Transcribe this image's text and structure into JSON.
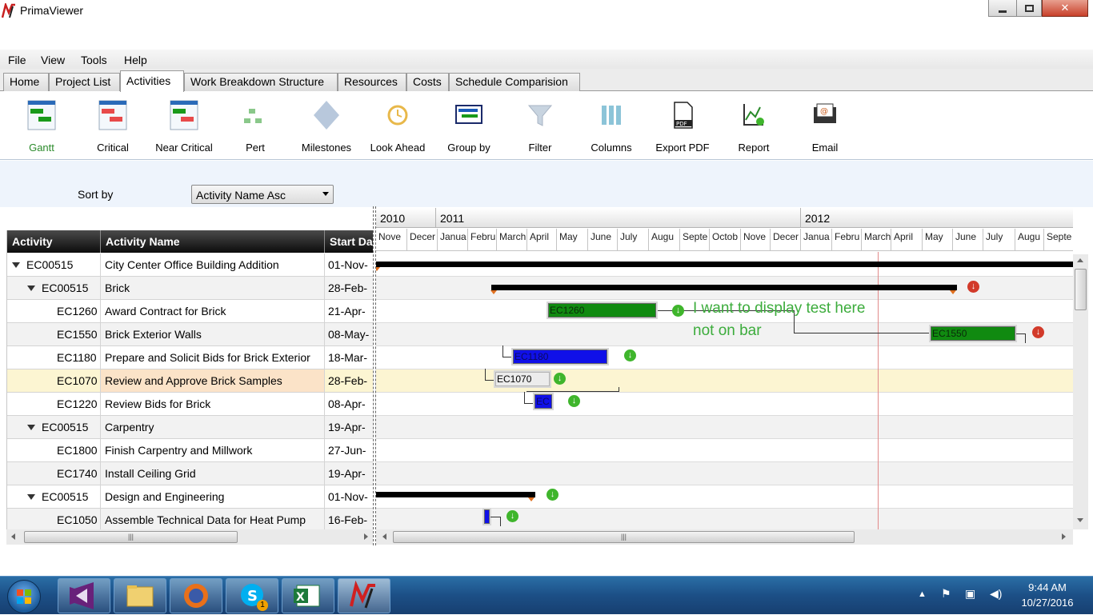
{
  "window": {
    "title": "PrimaViewer"
  },
  "menu": [
    "File",
    "View",
    "Tools",
    "Help"
  ],
  "tabs": [
    "Home",
    "Project List",
    "Activities",
    "Work Breakdown Structure",
    "Resources",
    "Costs",
    "Schedule Comparision"
  ],
  "ribbon": {
    "gantt": "Gantt",
    "critical": "Critical",
    "near_critical": "Near Critical",
    "pert": "Pert",
    "milestones": "Milestones",
    "look_ahead": "Look Ahead",
    "group_by": "Group by",
    "filter": "Filter",
    "columns": "Columns",
    "export_pdf": "Export PDF",
    "report": "Report",
    "email": "Email",
    "active_color": "#2a8a2a"
  },
  "sort": {
    "label": "Sort by",
    "value": "Activity Name Asc"
  },
  "grid": {
    "columns": [
      "Activity",
      "Activity Name",
      "Start Da"
    ],
    "rows": [
      {
        "id": "EC00515",
        "name": "City Center Office Building Addition",
        "start": "01-Nov-"
      },
      {
        "id": "EC00515",
        "name": "Brick",
        "start": "28-Feb-"
      },
      {
        "id": "EC1260",
        "name": "Award Contract for Brick",
        "start": "21-Apr-"
      },
      {
        "id": "EC1550",
        "name": "Brick Exterior Walls",
        "start": "08-May-"
      },
      {
        "id": "EC1180",
        "name": "Prepare and Solicit Bids for Brick Exterior",
        "start": "18-Mar-"
      },
      {
        "id": "EC1070",
        "name": "Review and Approve Brick Samples",
        "start": "28-Feb-"
      },
      {
        "id": "EC1220",
        "name": "Review Bids for Brick",
        "start": "08-Apr-"
      },
      {
        "id": "EC00515",
        "name": "Carpentry",
        "start": "19-Apr-"
      },
      {
        "id": "EC1800",
        "name": "Finish Carpentry and Millwork",
        "start": "27-Jun-"
      },
      {
        "id": "EC1740",
        "name": "Install Ceiling Grid",
        "start": "19-Apr-"
      },
      {
        "id": "EC00515",
        "name": "Design and Engineering",
        "start": "01-Nov-"
      },
      {
        "id": "EC1050",
        "name": "Assemble Technical Data for Heat Pump",
        "start": "16-Feb-"
      }
    ]
  },
  "timeline": {
    "years": [
      "2010",
      "2011",
      "2012"
    ],
    "months": [
      "Nove",
      "Decer",
      "Janua",
      "Febru",
      "March",
      "April",
      "May",
      "June",
      "July",
      "Augu",
      "Septe",
      "Octob",
      "Nove",
      "Decer",
      "Janua",
      "Febru",
      "March",
      "April",
      "May",
      "June",
      "July",
      "Augu",
      "Septe"
    ],
    "bar_labels": {
      "ec1260": "EC1260",
      "ec1550": "EC1550",
      "ec1180": "EC1180",
      "ec1070": "EC1070",
      "ec1220": "EC"
    },
    "annotation_line1": "I want to display test here",
    "annotation_line2": "not on bar"
  },
  "taskbar": {
    "time": "9:44 AM",
    "date": "10/27/2016",
    "skype_badge": "1"
  }
}
